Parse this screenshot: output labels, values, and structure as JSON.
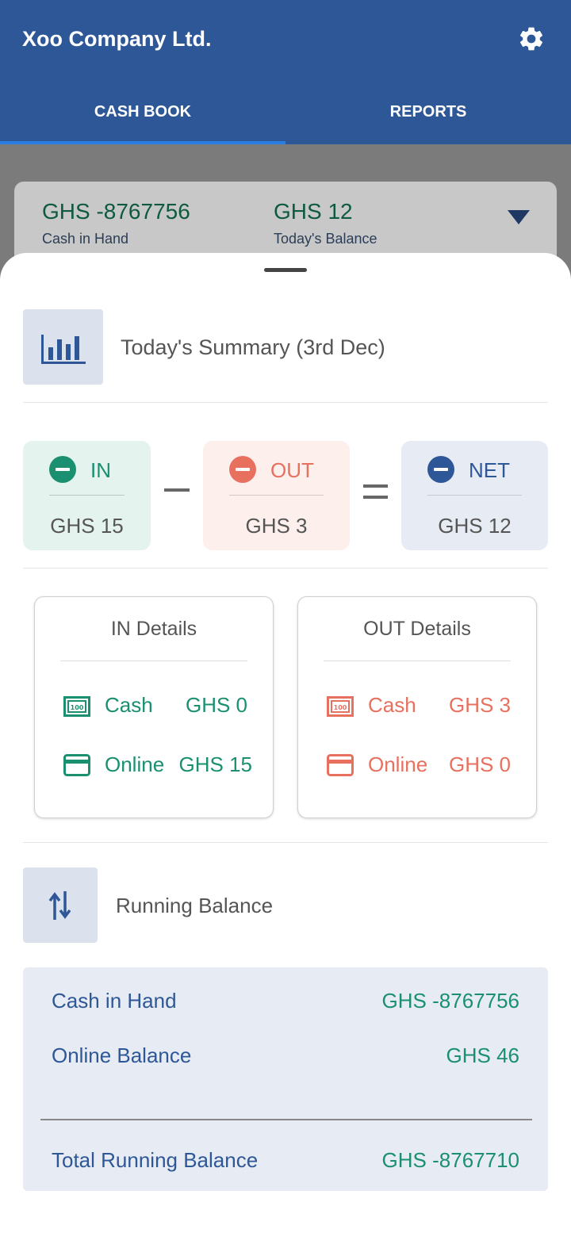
{
  "app": {
    "title": "Xoo Company Ltd.",
    "settings_icon": "gear-icon"
  },
  "tabs": [
    {
      "label": "CASH BOOK",
      "active": true
    },
    {
      "label": "REPORTS",
      "active": false
    }
  ],
  "balance_card": {
    "cash_in_hand_amount": "GHS -8767756",
    "cash_in_hand_label": "Cash in Hand",
    "today_balance_amount": "GHS 12",
    "today_balance_label": "Today's Balance"
  },
  "summary": {
    "title": "Today's Summary (3rd Dec)",
    "icon": "bar-chart-icon",
    "in": {
      "label": "IN",
      "amount": "GHS 15"
    },
    "out": {
      "label": "OUT",
      "amount": "GHS 3"
    },
    "net": {
      "label": "NET",
      "amount": "GHS 12"
    }
  },
  "in_details": {
    "title": "IN Details",
    "rows": [
      {
        "label": "Cash",
        "amount": "GHS 0",
        "icon": "cash-note-icon"
      },
      {
        "label": "Online",
        "amount": "GHS 15",
        "icon": "credit-card-icon"
      }
    ]
  },
  "out_details": {
    "title": "OUT Details",
    "rows": [
      {
        "label": "Cash",
        "amount": "GHS 3",
        "icon": "cash-note-icon"
      },
      {
        "label": "Online",
        "amount": "GHS 0",
        "icon": "credit-card-icon"
      }
    ]
  },
  "running_balance": {
    "title": "Running Balance",
    "icon": "swap-vertical-icon",
    "rows": [
      {
        "label": "Cash in Hand",
        "value": "GHS -8767756"
      },
      {
        "label": "Online Balance",
        "value": "GHS 46"
      }
    ],
    "total_label": "Total Running Balance",
    "total_value": "GHS -8767710"
  },
  "colors": {
    "primary": "#2e5797",
    "in_green": "#1a9070",
    "out_red": "#e8705f",
    "net_blue": "#2e5797",
    "tab_indicator": "#2a7de1"
  }
}
